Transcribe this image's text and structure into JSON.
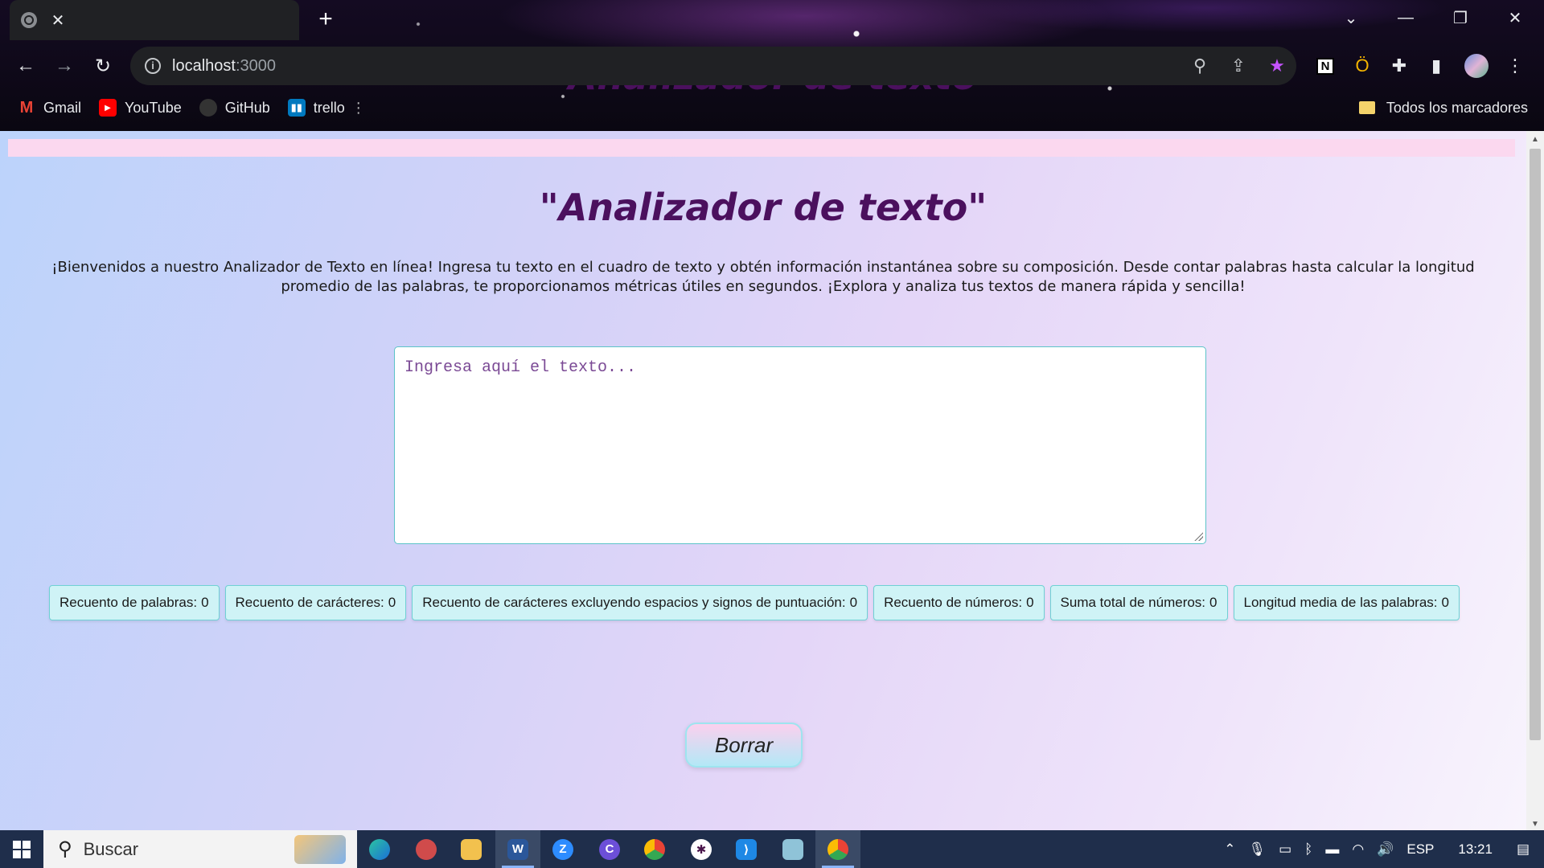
{
  "browser": {
    "tab_title": "Analizador de texto",
    "tab_close": "✕",
    "new_tab": "+",
    "url_host": "localhost",
    "url_port": ":3000",
    "bookmarks": [
      {
        "label": "Gmail",
        "icon": "gmail-icon",
        "color": "#ea4335"
      },
      {
        "label": "YouTube",
        "icon": "youtube-icon",
        "color": "#ff0000"
      },
      {
        "label": "GitHub",
        "icon": "github-icon",
        "color": "#333333"
      },
      {
        "label": "trello",
        "icon": "trello-icon",
        "color": "#0079bf"
      }
    ],
    "bookmarks_folder": "Todos los marcadores"
  },
  "page": {
    "title": "\"Analizador de texto\"",
    "intro": "¡Bienvenidos a nuestro Analizador de Texto en línea! Ingresa tu texto en el cuadro de texto y obtén información instantánea sobre su composición. Desde contar palabras hasta calcular la longitud promedio de las palabras, te proporcionamos métricas útiles en segundos. ¡Explora y analiza tus textos de manera rápida y sencilla!",
    "textarea_placeholder": "Ingresa aquí el texto...",
    "stats": [
      {
        "label": "Recuento de palabras:",
        "value": "0"
      },
      {
        "label": "Recuento de carácteres:",
        "value": "0"
      },
      {
        "label": "Recuento de carácteres excluyendo espacios y signos de puntuación:",
        "value": "0"
      },
      {
        "label": "Recuento de números:",
        "value": "0"
      },
      {
        "label": "Suma total de números:",
        "value": "0"
      },
      {
        "label": "Longitud media de las palabras:",
        "value": "0"
      }
    ],
    "clear_button": "Borrar"
  },
  "taskbar": {
    "search_label": "Buscar",
    "language": "ESP",
    "time": "13:21"
  },
  "colors": {
    "title": "#4b105e",
    "stat_bg": "#cff3f6",
    "stat_border": "#6fd0d4",
    "accent_star": "#c653ff"
  }
}
